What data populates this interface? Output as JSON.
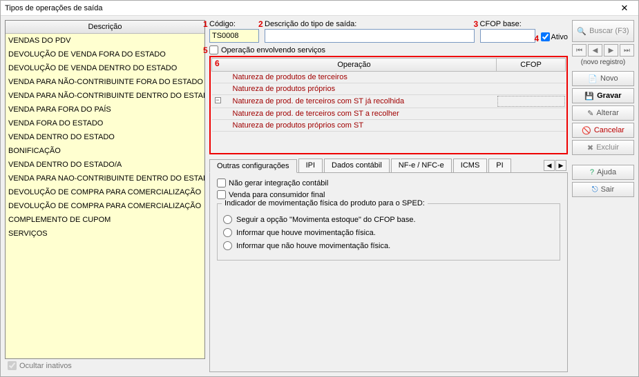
{
  "window": {
    "title": "Tipos de operações de saída"
  },
  "list": {
    "header": "Descrição",
    "items": [
      "VENDAS DO PDV",
      "DEVOLUÇÃO DE VENDA FORA DO ESTADO",
      "DEVOLUÇÃO DE VENDA DENTRO DO ESTADO",
      "VENDA PARA NÃO-CONTRIBUINTE FORA DO ESTADO",
      "VENDA PARA NÃO-CONTRIBUINTE DENTRO DO ESTADO",
      "VENDA PARA FORA DO PAÍS",
      "VENDA FORA DO ESTADO",
      "VENDA DENTRO DO ESTADO",
      "BONIFICAÇÃO",
      "VENDA DENTRO DO ESTADO/A",
      "VENDA PARA NAO-CONTRIBUINTE DENTRO DO ESTADO",
      "DEVOLUÇÃO DE COMPRA PARA COMERCIALIZAÇÃO",
      "DEVOLUÇÃO DE COMPRA PARA COMERCIALIZAÇÃO",
      "COMPLEMENTO DE CUPOM",
      "SERVIÇOS"
    ],
    "hide_inactive_label": "Ocultar inativos",
    "hide_inactive_checked": true
  },
  "form": {
    "codigo_label": "Código:",
    "codigo_value": "TS0008",
    "descricao_label": "Descrição do tipo de saída:",
    "descricao_value": "",
    "cfop_base_label": "CFOP base:",
    "cfop_base_value": "",
    "ativo_label": "Ativo",
    "ativo_checked": true,
    "servicos_label": "Operação envolvendo serviços",
    "markers": {
      "codigo": "1",
      "descricao": "2",
      "cfop_base": "3",
      "ativo": "4",
      "servicos": "5",
      "grid": "6"
    }
  },
  "op_table": {
    "operacao_header": "Operação",
    "cfop_header": "CFOP",
    "rows": [
      "Natureza de produtos de terceiros",
      "Natureza de produtos próprios",
      "Natureza de prod. de terceiros com ST já recolhida",
      "Natureza de prod. de terceiros com ST a recolher",
      "Natureza de produtos próprios com ST"
    ],
    "selected_row_index": 2
  },
  "tabs": {
    "items": [
      "Outras configurações",
      "IPI",
      "Dados contábil",
      "NF-e / NFC-e",
      "ICMS",
      "PIS"
    ],
    "active_index": 0,
    "more_hint_cut": "PI"
  },
  "tab_main": {
    "nao_gerar_label": "Não gerar integração contábil",
    "consumidor_final_label": "Venda para consumidor final",
    "group_legend": "Indicador de movimentação física do produto para o SPED:",
    "radio_seguir": "Seguir a opção \"Movimenta estoque\" do CFOP base.",
    "radio_houve": "Informar que houve movimentação física.",
    "radio_nao_houve": "Informar que não houve movimentação física."
  },
  "actions": {
    "buscar": "Buscar (F3)",
    "novo_reg": "(novo registro)",
    "novo": "Novo",
    "gravar": "Gravar",
    "alterar": "Alterar",
    "cancelar": "Cancelar",
    "excluir": "Excluir",
    "ajuda": "Ajuda",
    "sair": "Sair"
  }
}
